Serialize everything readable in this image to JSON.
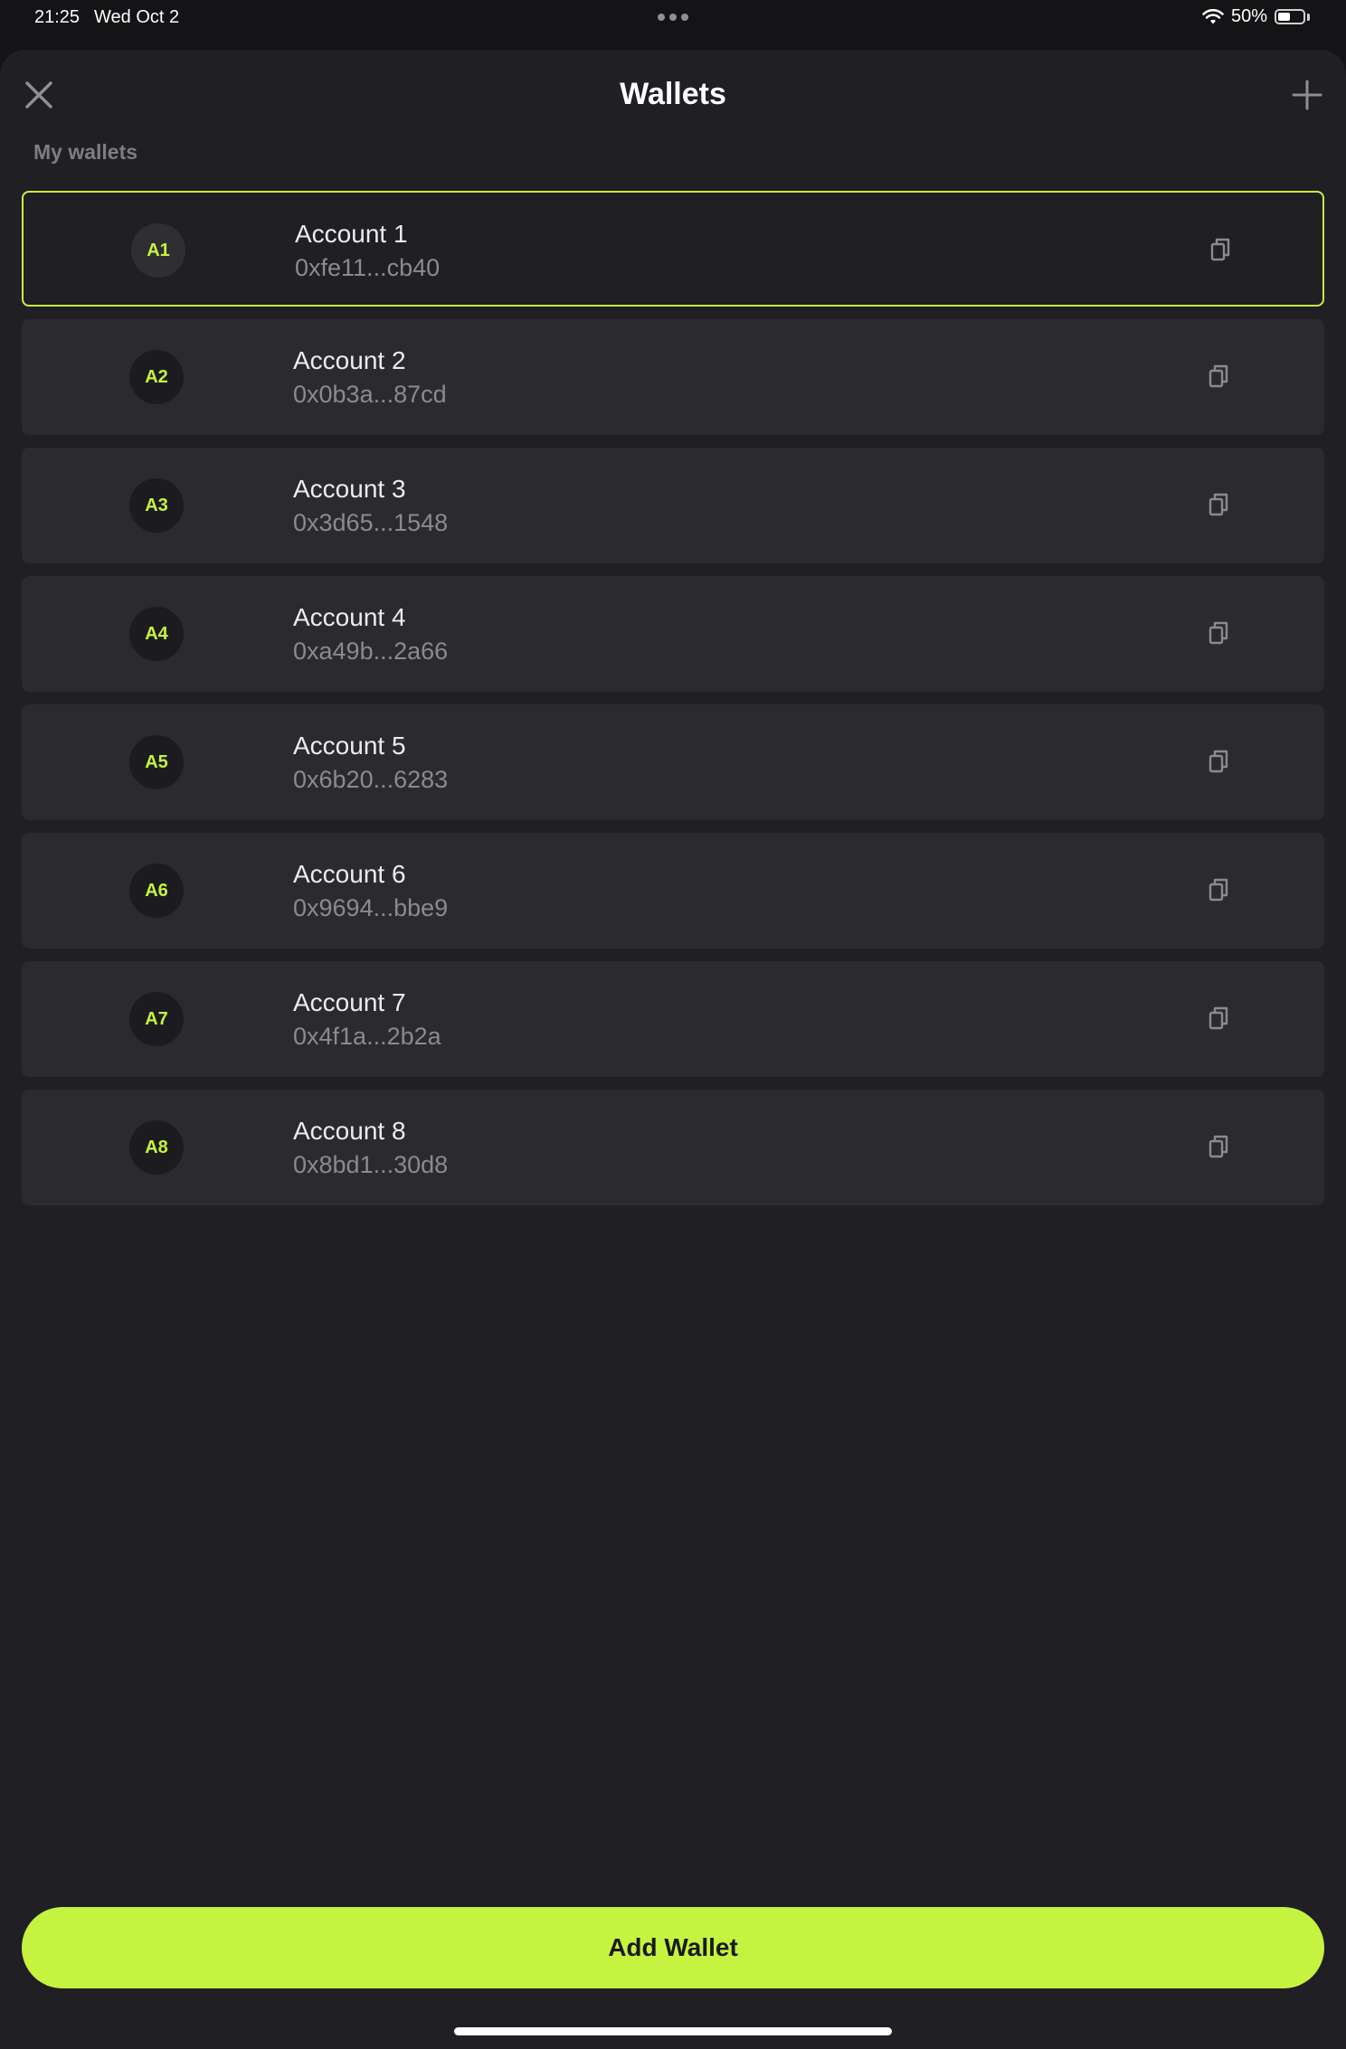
{
  "status_bar": {
    "time": "21:25",
    "date": "Wed Oct 2",
    "battery": "50%",
    "battery_level": 0.5
  },
  "header": {
    "title": "Wallets",
    "close_icon": "close-icon",
    "add_icon": "plus-icon"
  },
  "section_label": "My wallets",
  "wallets": [
    {
      "initials": "A1",
      "name": "Account 1",
      "address": "0xfe11...cb40",
      "selected": true
    },
    {
      "initials": "A2",
      "name": "Account 2",
      "address": "0x0b3a...87cd",
      "selected": false
    },
    {
      "initials": "A3",
      "name": "Account 3",
      "address": "0x3d65...1548",
      "selected": false
    },
    {
      "initials": "A4",
      "name": "Account 4",
      "address": "0xa49b...2a66",
      "selected": false
    },
    {
      "initials": "A5",
      "name": "Account 5",
      "address": "0x6b20...6283",
      "selected": false
    },
    {
      "initials": "A6",
      "name": "Account 6",
      "address": "0x9694...bbe9",
      "selected": false
    },
    {
      "initials": "A7",
      "name": "Account 7",
      "address": "0x4f1a...2b2a",
      "selected": false
    },
    {
      "initials": "A8",
      "name": "Account 8",
      "address": "0x8bd1...30d8",
      "selected": false
    }
  ],
  "add_wallet_label": "Add Wallet",
  "colors": {
    "accent": "#c5f33f",
    "background": "#1f1f24",
    "card": "#2a2a2f"
  }
}
